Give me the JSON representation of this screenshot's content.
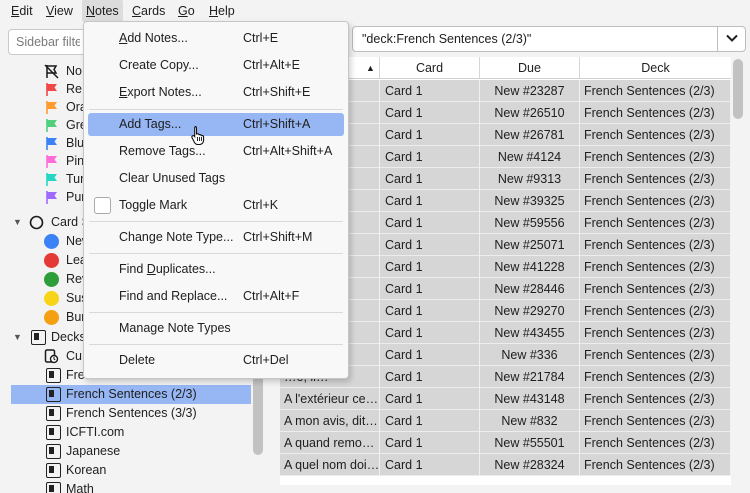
{
  "menubar": {
    "items": [
      {
        "label": "Edit",
        "mnemonic": "E",
        "rest": "dit"
      },
      {
        "label": "View",
        "mnemonic": "V",
        "rest": "iew"
      },
      {
        "label": "Notes",
        "mnemonic": "N",
        "rest": "otes"
      },
      {
        "label": "Cards",
        "mnemonic": "C",
        "rest": "ards"
      },
      {
        "label": "Go",
        "mnemonic": "G",
        "rest": "o"
      },
      {
        "label": "Help",
        "mnemonic": "H",
        "rest": "elp"
      }
    ],
    "active": "Notes"
  },
  "sidebar": {
    "filter_placeholder": "Sidebar filter",
    "flags": [
      "No",
      "Re",
      "Ora",
      "Gre",
      "Blu",
      "Pin",
      "Tur",
      "Pur"
    ],
    "card_state": {
      "label": "Card S",
      "items": [
        "New",
        "Lea",
        "Rev",
        "Sus",
        "Bur"
      ]
    },
    "decks": {
      "label": "Decks",
      "items": [
        "Cu",
        "Fre",
        "French Sentences (2/3)",
        "French Sentences (3/3)",
        "ICFTI.com",
        "Japanese",
        "Korean",
        "Math"
      ]
    },
    "selected": "French Sentences (2/3)",
    "hidden_partial": "(…)"
  },
  "colors": {
    "flag_no": "#1a1a1a",
    "flag_red": "#f04747",
    "flag_orange": "#ff9b2f",
    "flag_green": "#52cf7a",
    "flag_blue": "#3b82f6",
    "flag_pink": "#ff6bdb",
    "flag_turquoise": "#26d6c2",
    "flag_purple": "#9f6bff",
    "new": "#3b82f6",
    "learn": "#e53935",
    "review": "#2e9e3b",
    "suspended": "#f7d417",
    "buried": "#f59f12",
    "selection": "#96b6f4"
  },
  "search": {
    "value": "\"deck:French Sentences (2/3)\""
  },
  "table": {
    "columns": [
      "",
      "Card",
      "Due",
      "Deck"
    ],
    "rows": [
      {
        "sort": "J'ai \"e…",
        "card": "Card 1",
        "due": "New #23287",
        "deck": "French Sentences (2/3)"
      },
      {
        "sort": "C'est-…",
        "card": "Card 1",
        "due": "New #26510",
        "deck": "French Sentences (2/3)"
      },
      {
        "sort": "…te…",
        "card": "Card 1",
        "due": "New #26781",
        "deck": "French Sentences (2/3)"
      },
      {
        "sort": "…",
        "card": "Card 1",
        "due": "New #4124",
        "deck": "French Sentences (2/3)"
      },
      {
        "sort": "…ne…",
        "card": "Card 1",
        "due": "New #9313",
        "deck": "French Sentences (2/3)"
      },
      {
        "sort": "…nt…",
        "card": "Card 1",
        "due": "New #39325",
        "deck": "French Sentences (2/3)"
      },
      {
        "sort": "…ur …",
        "card": "Card 1",
        "due": "New #59556",
        "deck": "French Sentences (2/3)"
      },
      {
        "sort": "… v…",
        "card": "Card 1",
        "due": "New #25071",
        "deck": "French Sentences (2/3)"
      },
      {
        "sort": "… le…",
        "card": "Card 1",
        "due": "New #41228",
        "deck": "French Sentences (2/3)"
      },
      {
        "sort": "…ard…",
        "card": "Card 1",
        "due": "New #28446",
        "deck": "French Sentences (2/3)"
      },
      {
        "sort": "… c'…",
        "card": "Card 1",
        "due": "New #29270",
        "deck": "French Sentences (2/3)"
      },
      {
        "sort": "…au…",
        "card": "Card 1",
        "due": "New #43455",
        "deck": "French Sentences (2/3)"
      },
      {
        "sort": "…aim…",
        "card": "Card 1",
        "due": "New #336",
        "deck": "French Sentences (2/3)"
      },
      {
        "sort": "…e, il…",
        "card": "Card 1",
        "due": "New #21784",
        "deck": "French Sentences (2/3)"
      },
      {
        "sort": "A l'extérieur ce…",
        "card": "Card 1",
        "due": "New #43148",
        "deck": "French Sentences (2/3)"
      },
      {
        "sort": "A mon avis, dit…",
        "card": "Card 1",
        "due": "New #832",
        "deck": "French Sentences (2/3)"
      },
      {
        "sort": "A quand remo…",
        "card": "Card 1",
        "due": "New #55501",
        "deck": "French Sentences (2/3)"
      },
      {
        "sort": "A quel nom doi…",
        "card": "Card 1",
        "due": "New #28324",
        "deck": "French Sentences (2/3)"
      }
    ]
  },
  "notes_menu": {
    "items": [
      {
        "label": "Add Notes...",
        "shortcut": "Ctrl+E",
        "mnemonic_index": 0
      },
      {
        "label": "Create Copy...",
        "shortcut": "Ctrl+Alt+E",
        "mnemonic_index": -1
      },
      {
        "label": "Export Notes...",
        "shortcut": "Ctrl+Shift+E",
        "mnemonic_index": 0
      },
      {
        "label": "Add Tags...",
        "shortcut": "Ctrl+Shift+A",
        "mnemonic_index": -1
      },
      {
        "label": "Remove Tags...",
        "shortcut": "Ctrl+Alt+Shift+A",
        "mnemonic_index": -1
      },
      {
        "label": "Clear Unused Tags",
        "shortcut": "",
        "mnemonic_index": -1
      },
      {
        "label": "Toggle Mark",
        "shortcut": "Ctrl+K",
        "mnemonic_index": -1
      },
      {
        "label": "Change Note Type...",
        "shortcut": "Ctrl+Shift+M",
        "mnemonic_index": -1
      },
      {
        "label": "Find Duplicates...",
        "shortcut": "",
        "mnemonic_index": 6
      },
      {
        "label": "Find and Replace...",
        "shortcut": "Ctrl+Alt+F",
        "mnemonic_index": -1
      },
      {
        "label": "Manage Note Types",
        "shortcut": "",
        "mnemonic_index": -1
      },
      {
        "label": "Delete",
        "shortcut": "Ctrl+Del",
        "mnemonic_index": -1
      }
    ],
    "hovered": "Add Tags..."
  }
}
